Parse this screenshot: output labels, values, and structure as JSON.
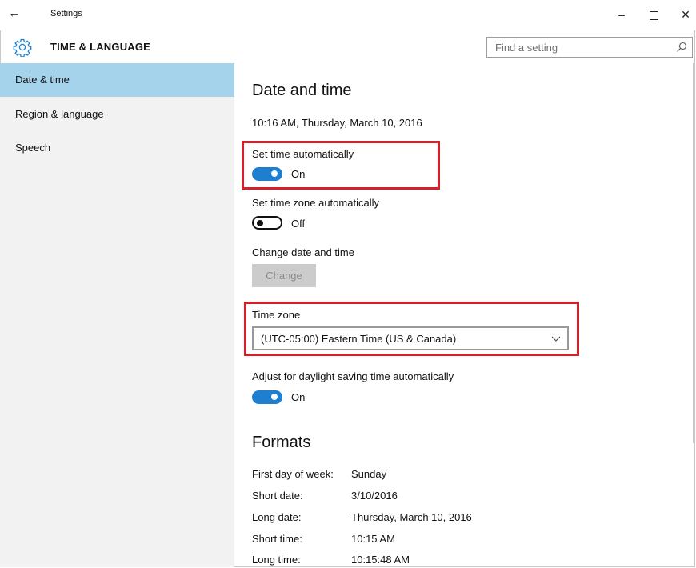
{
  "window": {
    "title": "Settings",
    "back_glyph": "←",
    "minimize_glyph": "–",
    "close_glyph": "✕"
  },
  "header": {
    "title": "TIME & LANGUAGE",
    "icon": "gear-icon",
    "search_placeholder": "Find a setting"
  },
  "sidebar": {
    "items": [
      {
        "label": "Date & time",
        "active": true
      },
      {
        "label": "Region & language",
        "active": false
      },
      {
        "label": "Speech",
        "active": false
      }
    ]
  },
  "main": {
    "section_title": "Date and time",
    "current_datetime": "10:16 AM, Thursday, March 10, 2016",
    "set_time_auto": {
      "label": "Set time automatically",
      "state": "On"
    },
    "set_tz_auto": {
      "label": "Set time zone automatically",
      "state": "Off"
    },
    "change_date": {
      "label": "Change date and time",
      "button": "Change"
    },
    "time_zone": {
      "label": "Time zone",
      "value": "(UTC-05:00) Eastern Time (US & Canada)"
    },
    "dst": {
      "label": "Adjust for daylight saving time automatically",
      "state": "On"
    },
    "formats": {
      "title": "Formats",
      "rows": [
        {
          "label": "First day of week:",
          "value": "Sunday"
        },
        {
          "label": "Short date:",
          "value": "3/10/2016"
        },
        {
          "label": "Long date:",
          "value": "Thursday, March 10, 2016"
        },
        {
          "label": "Short time:",
          "value": "10:15 AM"
        },
        {
          "label": "Long time:",
          "value": "10:15:48 AM"
        }
      ]
    }
  },
  "colors": {
    "accent": "#1e7fd0",
    "nav_active": "#a6d3ec",
    "highlight": "#d51f2b"
  }
}
